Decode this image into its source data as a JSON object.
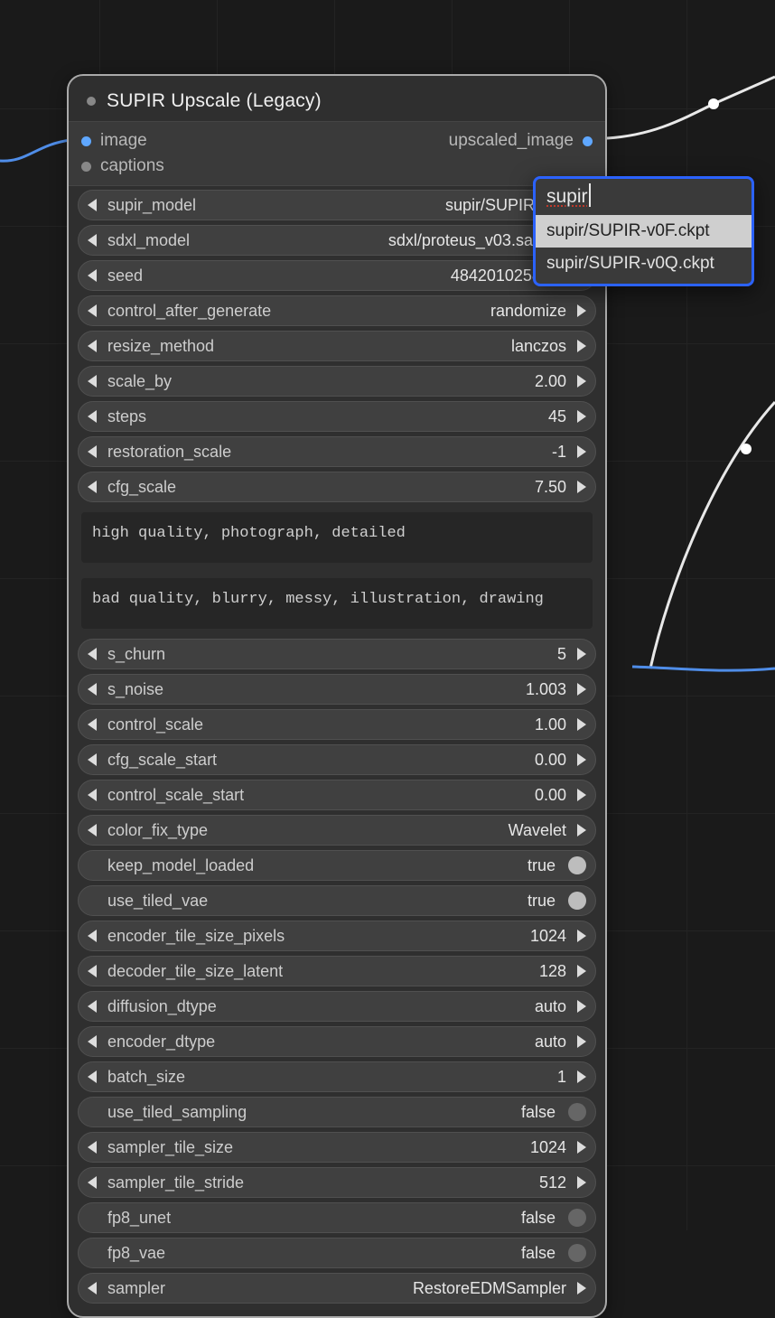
{
  "node": {
    "title": "SUPIR Upscale (Legacy)",
    "inputs": {
      "image": "image",
      "captions": "captions"
    },
    "outputs": {
      "upscaled_image": "upscaled_image"
    }
  },
  "w": {
    "supir_model": {
      "label": "supir_model",
      "value": "supir/SUPIR-v0F.ck"
    },
    "sdxl_model": {
      "label": "sdxl_model",
      "value": "sdxl/proteus_v03.safetenso"
    },
    "seed": {
      "label": "seed",
      "value": "484201025835040"
    },
    "control_after_generate": {
      "label": "control_after_generate",
      "value": "randomize"
    },
    "resize_method": {
      "label": "resize_method",
      "value": "lanczos"
    },
    "scale_by": {
      "label": "scale_by",
      "value": "2.00"
    },
    "steps": {
      "label": "steps",
      "value": "45"
    },
    "restoration_scale": {
      "label": "restoration_scale",
      "value": "-1"
    },
    "cfg_scale": {
      "label": "cfg_scale",
      "value": "7.50"
    },
    "pos_prompt": "high quality, photograph, detailed",
    "neg_prompt": "bad quality, blurry, messy, illustration, drawing",
    "s_churn": {
      "label": "s_churn",
      "value": "5"
    },
    "s_noise": {
      "label": "s_noise",
      "value": "1.003"
    },
    "control_scale": {
      "label": "control_scale",
      "value": "1.00"
    },
    "cfg_scale_start": {
      "label": "cfg_scale_start",
      "value": "0.00"
    },
    "control_scale_start": {
      "label": "control_scale_start",
      "value": "0.00"
    },
    "color_fix_type": {
      "label": "color_fix_type",
      "value": "Wavelet"
    },
    "keep_model_loaded": {
      "label": "keep_model_loaded",
      "value": "true"
    },
    "use_tiled_vae": {
      "label": "use_tiled_vae",
      "value": "true"
    },
    "encoder_tile_size_pixels": {
      "label": "encoder_tile_size_pixels",
      "value": "1024"
    },
    "decoder_tile_size_latent": {
      "label": "decoder_tile_size_latent",
      "value": "128"
    },
    "diffusion_dtype": {
      "label": "diffusion_dtype",
      "value": "auto"
    },
    "encoder_dtype": {
      "label": "encoder_dtype",
      "value": "auto"
    },
    "batch_size": {
      "label": "batch_size",
      "value": "1"
    },
    "use_tiled_sampling": {
      "label": "use_tiled_sampling",
      "value": "false"
    },
    "sampler_tile_size": {
      "label": "sampler_tile_size",
      "value": "1024"
    },
    "sampler_tile_stride": {
      "label": "sampler_tile_stride",
      "value": "512"
    },
    "fp8_unet": {
      "label": "fp8_unet",
      "value": "false"
    },
    "fp8_vae": {
      "label": "fp8_vae",
      "value": "false"
    },
    "sampler": {
      "label": "sampler",
      "value": "RestoreEDMSampler"
    }
  },
  "popup": {
    "search": "supir",
    "options": [
      "supir/SUPIR-v0F.ckpt",
      "supir/SUPIR-v0Q.ckpt"
    ]
  }
}
